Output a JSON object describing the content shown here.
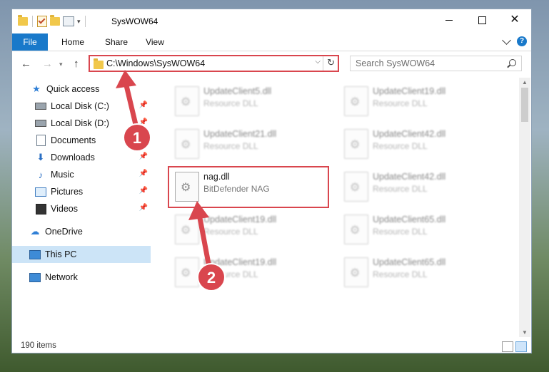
{
  "window": {
    "title": "SysWOW64",
    "controls": {
      "minimize": "minimize",
      "maximize": "maximize",
      "close": "✕"
    }
  },
  "ribbon": {
    "tabs": [
      {
        "label": "File",
        "active": true
      },
      {
        "label": "Home"
      },
      {
        "label": "Share"
      },
      {
        "label": "View"
      }
    ]
  },
  "nav": {
    "address": "C:\\Windows\\SysWOW64",
    "search_placeholder": "Search SysWOW64"
  },
  "sidebar": {
    "items": [
      {
        "label": "Quick access",
        "icon": "star-icon"
      },
      {
        "label": "Local Disk (C:)",
        "icon": "disk-icon",
        "pinned": true
      },
      {
        "label": "Local Disk (D:)",
        "icon": "disk-icon",
        "pinned": true
      },
      {
        "label": "Documents",
        "icon": "documents-icon",
        "pinned": true
      },
      {
        "label": "Downloads",
        "icon": "downloads-icon",
        "pinned": true
      },
      {
        "label": "Music",
        "icon": "music-icon",
        "pinned": true
      },
      {
        "label": "Pictures",
        "icon": "pictures-icon",
        "pinned": true
      },
      {
        "label": "Videos",
        "icon": "videos-icon",
        "pinned": true
      },
      {
        "label": "OneDrive",
        "icon": "onedrive-icon"
      },
      {
        "label": "This PC",
        "icon": "pc-icon",
        "selected": true
      },
      {
        "label": "Network",
        "icon": "network-icon"
      }
    ]
  },
  "files": [
    {
      "name": "UpdateClient5.dll",
      "type": "Resource DLL"
    },
    {
      "name": "UpdateClient19.dll",
      "type": "Resource DLL"
    },
    {
      "name": "UpdateClient21.dll",
      "type": "Resource DLL"
    },
    {
      "name": "UpdateClient42.dll",
      "type": "Resource DLL"
    },
    {
      "name": "nag.dll",
      "type": "BitDefender NAG",
      "highlighted": true
    },
    {
      "name": "UpdateClient42.dll",
      "type": "Resource DLL"
    },
    {
      "name": "UpdateClient19.dll",
      "type": "Resource DLL"
    },
    {
      "name": "UpdateClient65.dll",
      "type": "Resource DLL"
    },
    {
      "name": "UpdateClient19.dll",
      "type": "Resource DLL"
    },
    {
      "name": "UpdateClient65.dll",
      "type": "Resource DLL"
    }
  ],
  "annotations": {
    "badge1": "1",
    "badge2": "2",
    "color": "#d9464e"
  },
  "status": {
    "item_count": "190 items"
  }
}
